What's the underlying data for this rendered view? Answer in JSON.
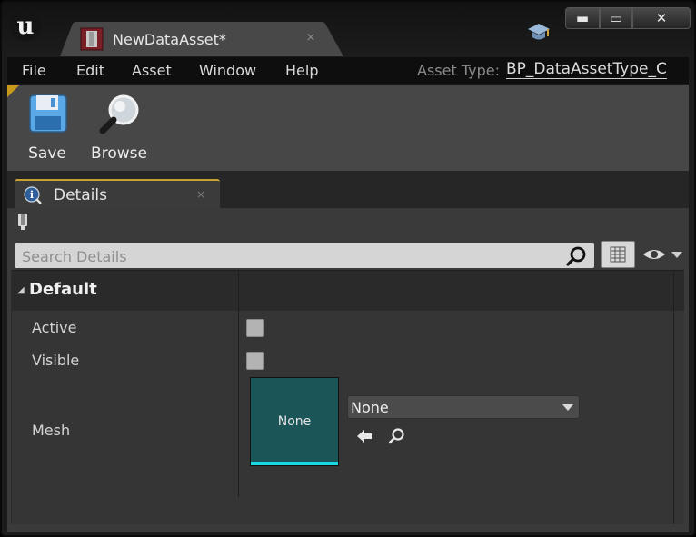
{
  "tab": {
    "title": "NewDataAsset*",
    "close": "×"
  },
  "window_controls": {
    "minimize": "▬",
    "maximize": "▭",
    "close": "✕"
  },
  "menu": [
    "File",
    "Edit",
    "Asset",
    "Window",
    "Help"
  ],
  "asset_type": {
    "label": "Asset Type:",
    "value": "BP_DataAssetType_C"
  },
  "toolbar": {
    "save_label": "Save",
    "browse_label": "Browse"
  },
  "details": {
    "tab_label": "Details",
    "tab_close": "×",
    "search_placeholder": "Search Details",
    "category": "Default",
    "properties": {
      "active": {
        "label": "Active",
        "checked": false
      },
      "visible": {
        "label": "Visible",
        "checked": false
      },
      "mesh": {
        "label": "Mesh",
        "thumbnail_text": "None",
        "selected": "None"
      }
    }
  },
  "colors": {
    "tab_accent": "#c8a231",
    "mesh_thumbnail": "#1c5558",
    "mesh_thumbnail_bar": "#19d8e0"
  }
}
